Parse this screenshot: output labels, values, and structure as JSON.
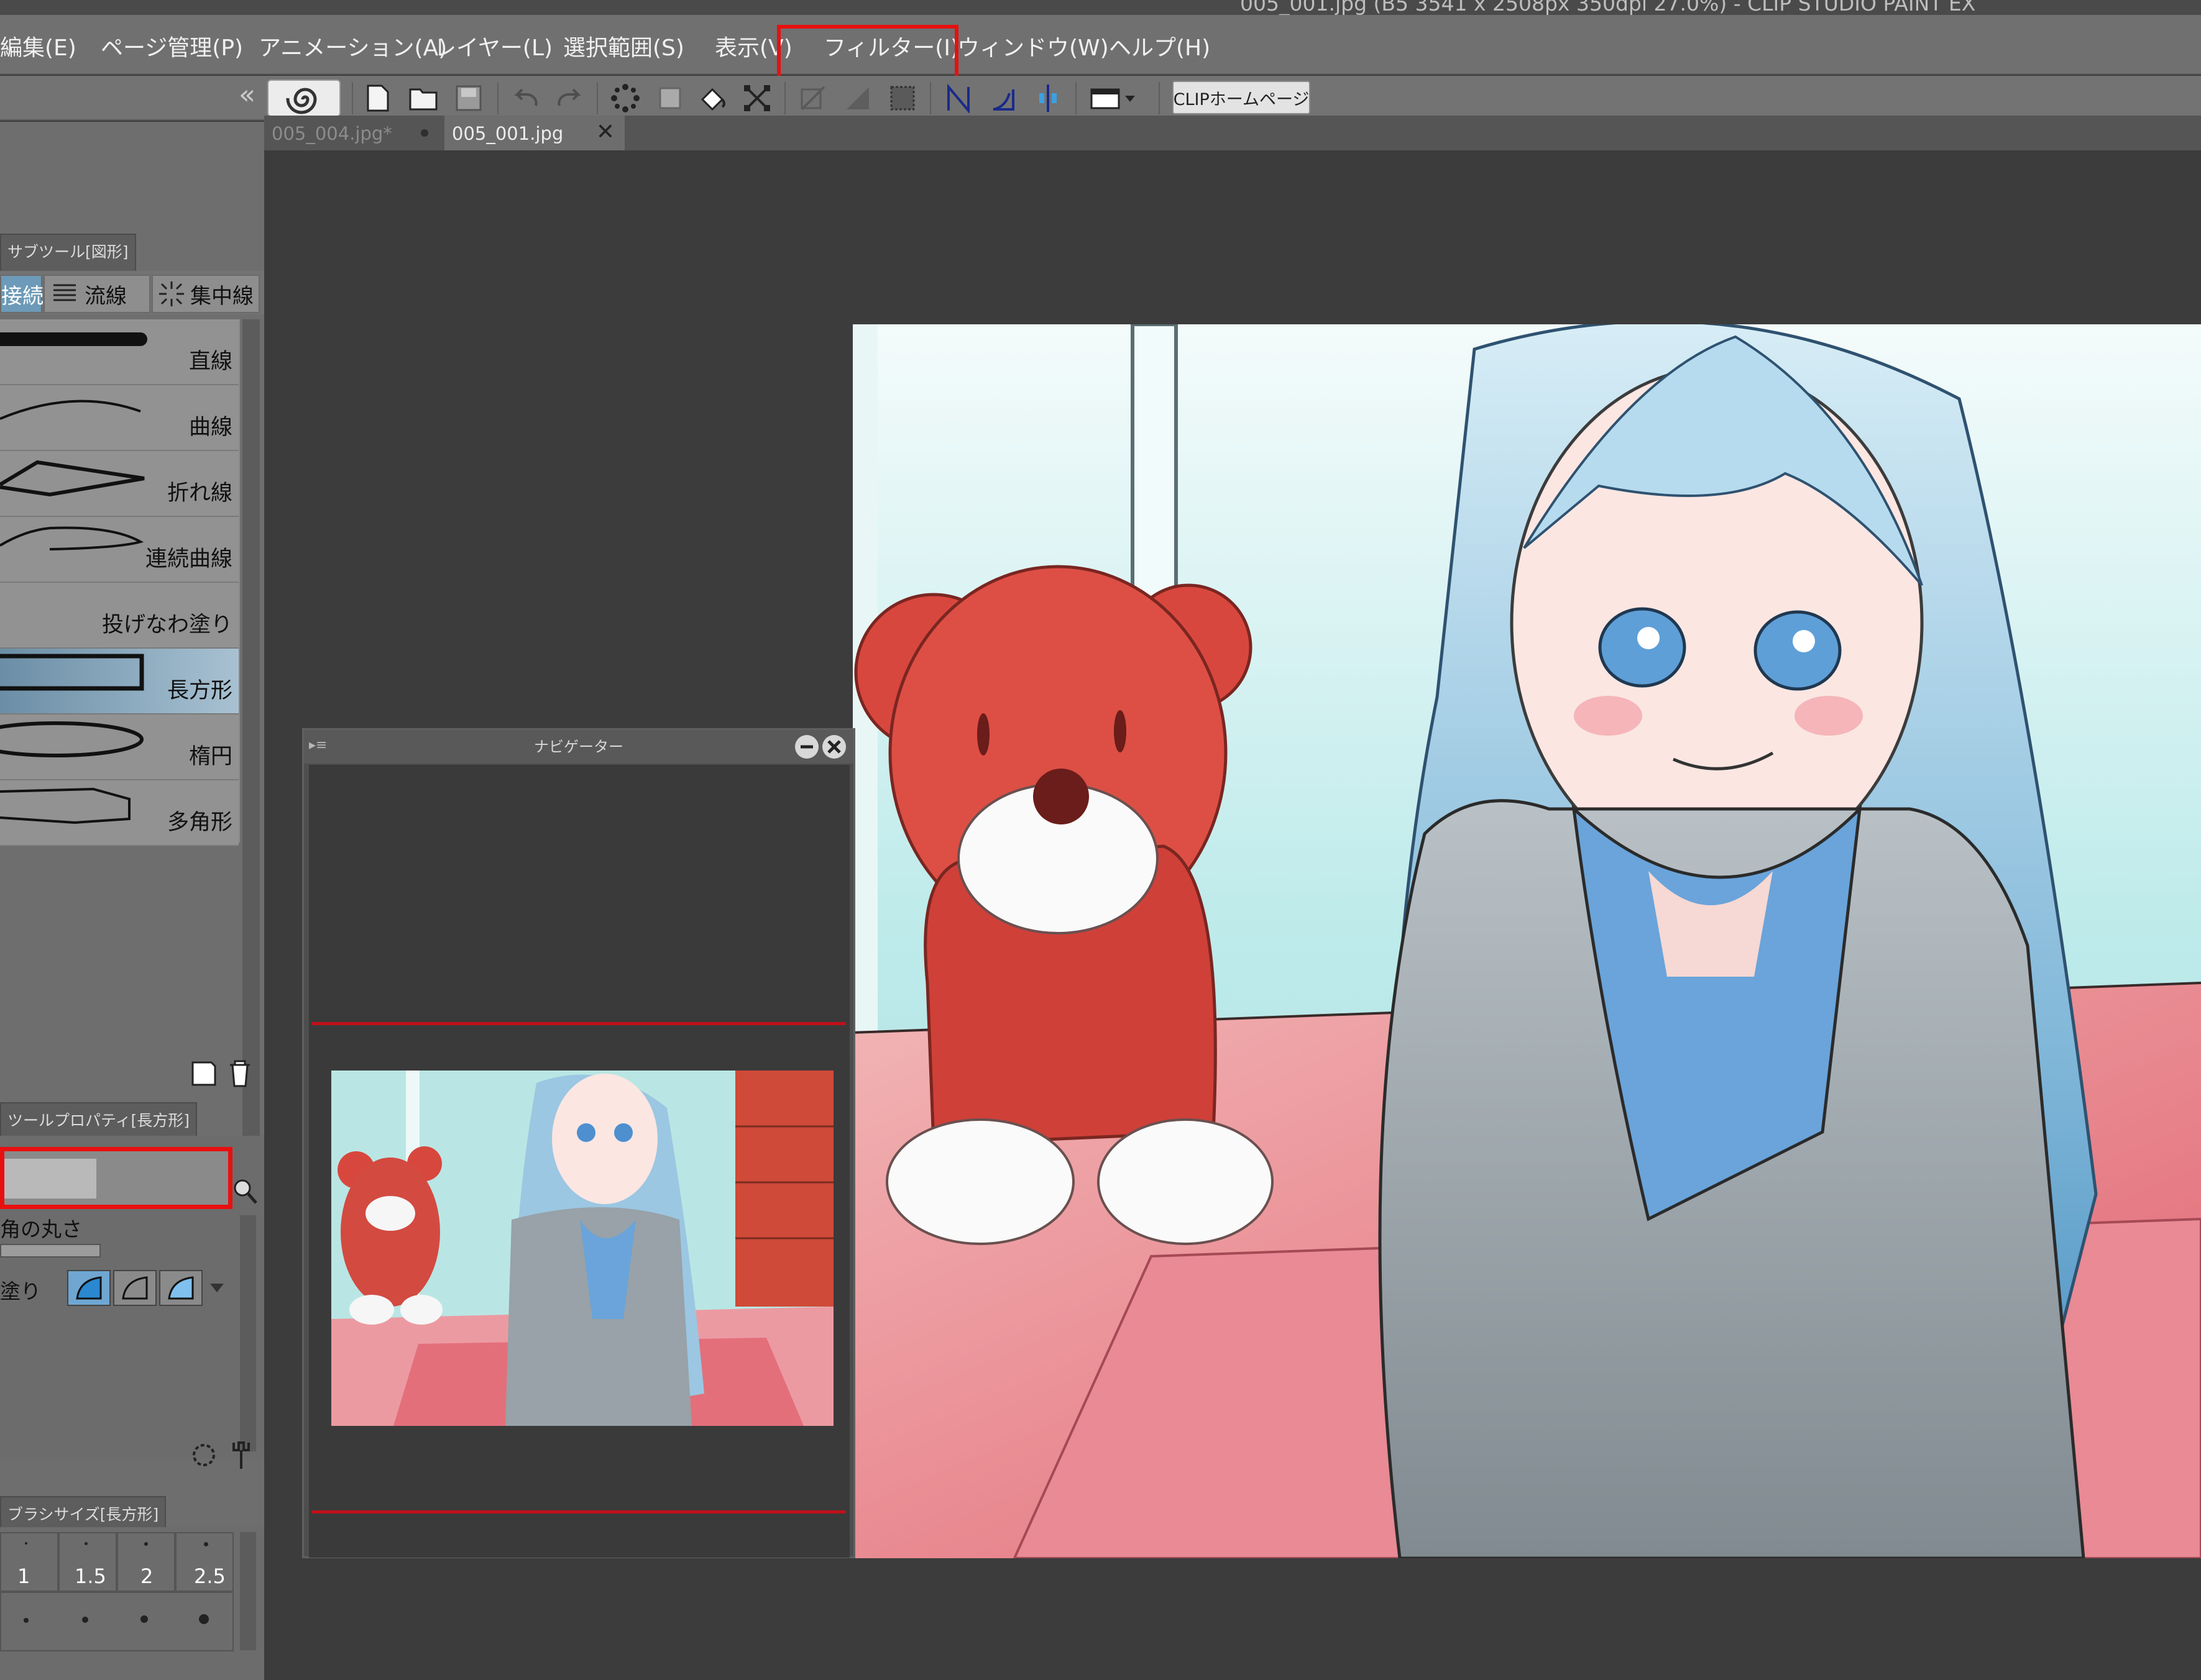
{
  "window": {
    "title": "005_001.jpg (B5 3541 x 2508px 350dpi 27.0%)  - CLIP STUDIO PAINT EX"
  },
  "menu": {
    "items": [
      "編集(E)",
      "ページ管理(P)",
      "アニメーション(A)",
      "レイヤー(L)",
      "選択範囲(S)",
      "表示(V)",
      "フィルター(I)",
      "ウィンドウ(W)",
      "ヘルプ(H)"
    ],
    "highlighted": "フィルター(I)"
  },
  "toolbar": {
    "clip_home_label": "CLIPホームページ"
  },
  "document_tabs": [
    {
      "label": "005_004.jpg*",
      "active": false
    },
    {
      "label": "005_001.jpg",
      "active": true
    }
  ],
  "subtool_panel": {
    "tab_label": "サブツール[図形]",
    "category_tabs": [
      "接続",
      "流線",
      "集中線"
    ],
    "tools": [
      "直線",
      "曲線",
      "折れ線",
      "連続曲線",
      "投げなわ塗り",
      "長方形",
      "楕円",
      "多角形"
    ],
    "selected_tool": "長方形"
  },
  "tool_property": {
    "tab_label": "ツールプロパティ[長方形]",
    "corner_label": "角の丸さ",
    "fill_label": "塗り"
  },
  "brush_size": {
    "tab_label": "ブラシサイズ[長方形]",
    "sizes": [
      "1",
      "1.5",
      "2",
      "2.5"
    ]
  },
  "navigator": {
    "title": "ナビゲーター"
  },
  "colors": {
    "highlight_red": "#e8100f",
    "menu_bg": "#707070",
    "canvas_bg": "#3c3c3c",
    "selected_tool": "#8fb0c5"
  }
}
